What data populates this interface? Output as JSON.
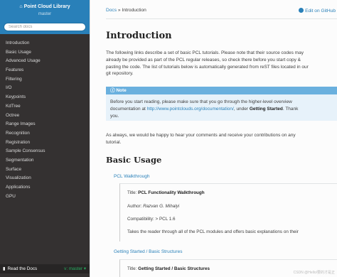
{
  "sidebar": {
    "brand": "Point Cloud Library",
    "version": "master",
    "search_placeholder": "Search docs",
    "items": [
      {
        "label": "Introduction"
      },
      {
        "label": "Basic Usage"
      },
      {
        "label": "Advanced Usage"
      },
      {
        "label": "Features"
      },
      {
        "label": "Filtering"
      },
      {
        "label": "I/O"
      },
      {
        "label": "Keypoints"
      },
      {
        "label": "KdTree"
      },
      {
        "label": "Octree"
      },
      {
        "label": "Range Images"
      },
      {
        "label": "Recognition"
      },
      {
        "label": "Registration"
      },
      {
        "label": "Sample Consensus"
      },
      {
        "label": "Segmentation"
      },
      {
        "label": "Surface"
      },
      {
        "label": "Visualization"
      },
      {
        "label": "Applications"
      },
      {
        "label": "GPU"
      }
    ],
    "footer": {
      "label": "Read the Docs",
      "version": "v: master"
    }
  },
  "header": {
    "breadcrumb_docs": "Docs",
    "breadcrumb_sep": "»",
    "breadcrumb_current": "Introduction",
    "github_link": "Edit on GitHub"
  },
  "main": {
    "title": "Introduction",
    "intro_lines": [
      "The following links describe a set of basic PCL tutorials. Please note that their source codes may",
      "already be provided as part of the PCL regular releases, so check there before you start copy &",
      "pasting the code. The list of tutorials below is automatically generated from reST files located in our",
      "git repository."
    ],
    "note": {
      "heading": "Note",
      "line1": "Before you start reading, please make sure that you go through the higher-level overview",
      "line2_prefix": "documentation at ",
      "line2_link": "http://www.pointclouds.org/documentation/",
      "line2_mid": ", under ",
      "line2_bold": "Getting Started",
      "line2_suffix": ". Thank",
      "line3": "you."
    },
    "contrib_lines": [
      "As always, we would be happy to hear your comments and receive your contributions on any",
      "tutorial."
    ],
    "section_title": "Basic Usage",
    "tutorials": [
      {
        "link": "PCL Walkthrough",
        "title_label": "Title: ",
        "title": "PCL Functionality Walkthrough",
        "author_label": "Author: ",
        "author": "Razvan G. Mihalyi",
        "compat": "Compatibility: > PCL 1.6",
        "desc": "Takes the reader through all of the PCL modules and offers basic explanations on their"
      },
      {
        "link": "Getting Started / Basic Structures",
        "title_label": "Title: ",
        "title": "Getting Started / Basic Structures"
      }
    ]
  },
  "watermark": "CSDN @Hello/要的才是正"
}
